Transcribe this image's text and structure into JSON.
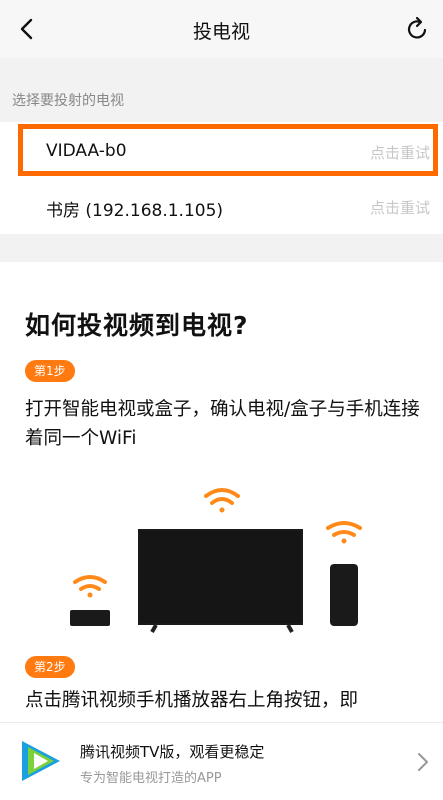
{
  "nav": {
    "title": "投电视",
    "back_icon": "back-chevron-icon",
    "refresh_icon": "refresh-icon"
  },
  "section_label": "选择要投射的电视",
  "devices": [
    {
      "name": "VIDAA-b0",
      "action": "点击重试",
      "highlighted": true
    },
    {
      "name": "书房 (192.168.1.105)",
      "action": "点击重试",
      "highlighted": false
    }
  ],
  "guide": {
    "title": "如何投视频到电视?",
    "steps": [
      {
        "badge": "第1步",
        "text": "打开智能电视或盒子，确认电视/盒子与手机连接着同一个WiFi"
      },
      {
        "badge": "第2步",
        "text": "点击腾讯视频手机播放器右上角按钮，即"
      }
    ]
  },
  "bottom_banner": {
    "title": "腾讯视频TV版，观看更稳定",
    "subtitle": "专为智能电视打造的APP",
    "logo_icon": "tencent-video-logo-icon",
    "chevron_icon": "chevron-right-icon"
  },
  "colors": {
    "accent": "#ff7a10",
    "highlight_border": "#ff6a00",
    "retry_text": "#c7c7c7"
  }
}
